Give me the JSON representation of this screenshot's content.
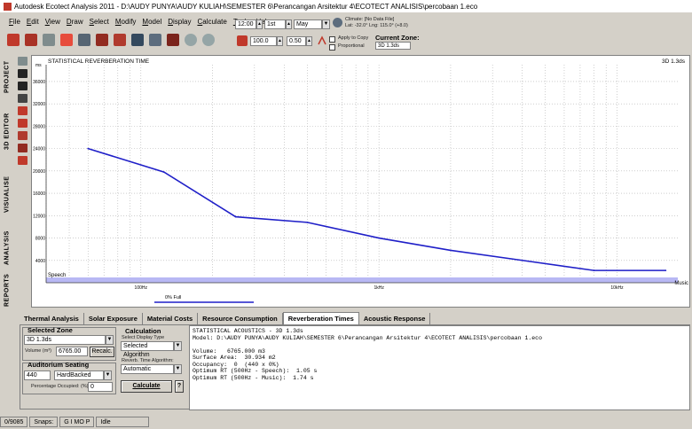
{
  "window": {
    "title": "Autodesk Ecotect Analysis 2011 - D:\\AUDY PUNYA\\AUDY KULIAH\\SEMESTER 6\\Perancangan Arsitektur 4\\ECOTECT ANALISIS\\percobaan 1.eco"
  },
  "menu": [
    "File",
    "Edit",
    "View",
    "Draw",
    "Select",
    "Modify",
    "Model",
    "Display",
    "Calculate",
    "Tools",
    "Help"
  ],
  "toolbar_icons": [
    "new-icon",
    "open-icon",
    "save-icon",
    "export-icon",
    "camera-icon",
    "render-icon",
    "material-icon",
    "analysis-icon",
    "shading-icon",
    "walk-icon",
    "undo-icon",
    "redo-icon"
  ],
  "date_time": {
    "time": "12:00",
    "day": "1st",
    "month": "May"
  },
  "climate": {
    "line1": "Climate: [No Data File]",
    "line2": "Lat: -32.0°   Lng: 115.0° (+8.0)"
  },
  "snap": {
    "value1": "100.0",
    "value2": "0.50",
    "apply_label": "Apply to Copy",
    "proportional_label": "Proportional"
  },
  "zone": {
    "label": "Current Zone:",
    "value": "3D 1.3ds"
  },
  "left_tabs": [
    "PROJECT",
    "3D EDITOR",
    "VISUALISE",
    "ANALYSIS",
    "REPORTS"
  ],
  "chart": {
    "title": "STATISTICAL REVERBERATION TIME",
    "zone_label": "3D 1.3ds",
    "y_unit": "ms",
    "speech_label": "Speech",
    "music_label": "Music",
    "legend_label": "0% Full"
  },
  "chart_data": {
    "type": "line",
    "title": "STATISTICAL REVERBERATION TIME",
    "ylabel": "ms",
    "y_ticks": [
      4000,
      8000,
      12000,
      16000,
      20000,
      24000,
      28000,
      32000,
      36000
    ],
    "ylim": [
      0,
      39000
    ],
    "x_ticks": [
      "100Hz",
      "1kHz",
      "10kHz"
    ],
    "x_scale": "log",
    "xlim": [
      40,
      18000
    ],
    "series": [
      {
        "name": "0% Full",
        "x": [
          60,
          125,
          250,
          500,
          1000,
          2000,
          4000,
          8000,
          16000
        ],
        "y": [
          24000,
          19800,
          11800,
          10800,
          8000,
          5800,
          4000,
          2200,
          2200
        ]
      }
    ],
    "optimum_band": {
      "speech": 1050,
      "music": 1740
    },
    "grid": true
  },
  "tabs": [
    {
      "label": "Thermal Analysis",
      "active": false
    },
    {
      "label": "Solar Exposure",
      "active": false
    },
    {
      "label": "Material Costs",
      "active": false
    },
    {
      "label": "Resource Consumption",
      "active": false
    },
    {
      "label": "Reverberation Times",
      "active": true
    },
    {
      "label": "Acoustic Response",
      "active": false
    }
  ],
  "selected_zone": {
    "heading": "Selected Zone",
    "zone": "3D 1.3ds",
    "volume_label": "Volume (m³)",
    "volume": "6765.00",
    "recalc": "Recalc."
  },
  "auditorium": {
    "heading": "Auditorium Seating",
    "seats": "440",
    "seat_type": "HardBacked",
    "pct_label": "Percentage Occupied: (%)",
    "pct": "0"
  },
  "calculation": {
    "heading": "Calculation",
    "display_type_label": "Select Display Type",
    "display_type": "Selected Algorithm",
    "algorithm_label": "Reverb. Time Algorithm:",
    "algorithm": "Automatic",
    "calculate": "Calculate",
    "help": "?"
  },
  "output_text": "STATISTICAL ACOUSTICS - 3D 1.3ds\nModel: D:\\AUDY PUNYA\\AUDY KULIAH\\SEMESTER 6\\Perancangan Arsitektur 4\\ECOTECT ANALISIS\\percobaan 1.eco\n\nVolume:   6765.000 m3\nSurface Area:  30.934 m2\nOccupancy:  0  (440 x 0%)\nOptimum RT (500Hz - Speech):  1.05 s\nOptimum RT (500Hz - Music):  1.74 s",
  "status": {
    "coord": "0/9085",
    "snaps_label": "Snaps:",
    "snaps": "G I   MO P",
    "state": "Idle"
  },
  "colors": {
    "series": "#1f1fc8",
    "band": "#b8b8f4",
    "accent": "#2020c0"
  }
}
